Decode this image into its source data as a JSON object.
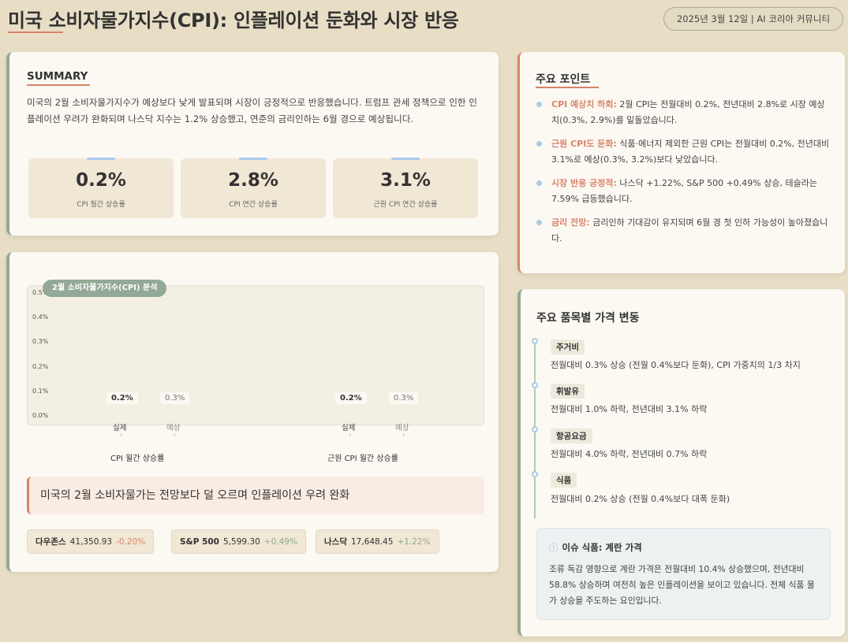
{
  "header": {
    "title": "미국 소비자물가지수(CPI): 인플레이션 둔화와 시장 반응",
    "date_label": "2025년 3월 12일 | AI 코리아 커뮤니티"
  },
  "summary": {
    "title": "SUMMARY",
    "text": "미국의 2월 소비자물가지수가 예상보다 낮게 발표되며 시장이 긍정적으로 반응했습니다. 트럼프 관세 정책으로 인한 인플레이션 우려가 완화되며 나스닥 지수는 1.2% 상승했고, 연준의 금리인하는 6월 경으로 예상됩니다.",
    "stats": [
      {
        "value": "0.2%",
        "label": "CPI 월간 상승률"
      },
      {
        "value": "2.8%",
        "label": "CPI 연간 상승률"
      },
      {
        "value": "3.1%",
        "label": "근원 CPI 연간 상승률"
      }
    ]
  },
  "chart": {
    "badge": "2월 소비자물가지수(CPI) 분석",
    "headline": "미국의 2월 소비자물가는 전망보다 덜 오르며 인플레이션 우려 완화",
    "indices": [
      {
        "name": "다우존스",
        "value": "41,350.93",
        "change": "-0.20%",
        "dir": "neg"
      },
      {
        "name": "S&P 500",
        "value": "5,599.30",
        "change": "+0.49%",
        "dir": "pos"
      },
      {
        "name": "나스닥",
        "value": "17,648.45",
        "change": "+1.22%",
        "dir": "pos"
      }
    ]
  },
  "chart_data": {
    "type": "bar",
    "title": "2월 소비자물가지수(CPI) 분석",
    "ylim": [
      0,
      0.5
    ],
    "yticks": [
      "0.5%",
      "0.4%",
      "0.3%",
      "0.2%",
      "0.1%",
      "0.0%"
    ],
    "groups": [
      {
        "name": "CPI 월간 상승률",
        "bars": [
          {
            "label": "실제",
            "value": 0.2,
            "text": "0.2%"
          },
          {
            "label": "예상",
            "value": 0.3,
            "text": "0.3%"
          }
        ]
      },
      {
        "name": "근원 CPI 월간 상승률",
        "bars": [
          {
            "label": "실제",
            "value": 0.2,
            "text": "0.2%"
          },
          {
            "label": "예상",
            "value": 0.3,
            "text": "0.3%"
          }
        ]
      }
    ]
  },
  "points": {
    "title": "주요 포인트",
    "items": [
      {
        "highlight": "CPI 예상치 하회:",
        "text": " 2월 CPI는 전월대비 0.2%, 전년대비 2.8%로 시장 예상치(0.3%, 2.9%)를 밑돌았습니다."
      },
      {
        "highlight": "근원 CPI도 둔화:",
        "text": " 식품·에너지 제외한 근원 CPI는 전월대비 0.2%, 전년대비 3.1%로 예상(0.3%, 3.2%)보다 낮았습니다."
      },
      {
        "highlight": "시장 반응 긍정적:",
        "text": " 나스닥 +1.22%, S&P 500 +0.49% 상승, 테슬라는 7.59% 급등했습니다."
      },
      {
        "highlight": "금리 전망:",
        "text": " 금리인하 기대감이 유지되며 6월 경 첫 인하 가능성이 높아졌습니다."
      }
    ]
  },
  "prices": {
    "title": "주요 품목별 가격 변동",
    "items": [
      {
        "tag": "주거비",
        "desc": "전월대비 0.3% 상승 (전월 0.4%보다 둔화), CPI 가중치의 1/3 차지"
      },
      {
        "tag": "휘발유",
        "desc": "전월대비 1.0% 하락, 전년대비 3.1% 하락"
      },
      {
        "tag": "항공요금",
        "desc": "전월대비 4.0% 하락, 전년대비 0.7% 하락"
      },
      {
        "tag": "식품",
        "desc": "전월대비 0.2% 상승 (전월 0.4%보다 대폭 둔화)"
      }
    ],
    "issue": {
      "icon": "ⓘ",
      "title": "이슈 식품: 계란 가격",
      "text": "조류 독감 영향으로 계란 가격은 전월대비 10.4% 상승했으며, 전년대비 58.8% 상승하며 여전히 높은 인플레이션을 보이고 있습니다. 전체 식품 물가 상승을 주도하는 요인입니다."
    }
  }
}
